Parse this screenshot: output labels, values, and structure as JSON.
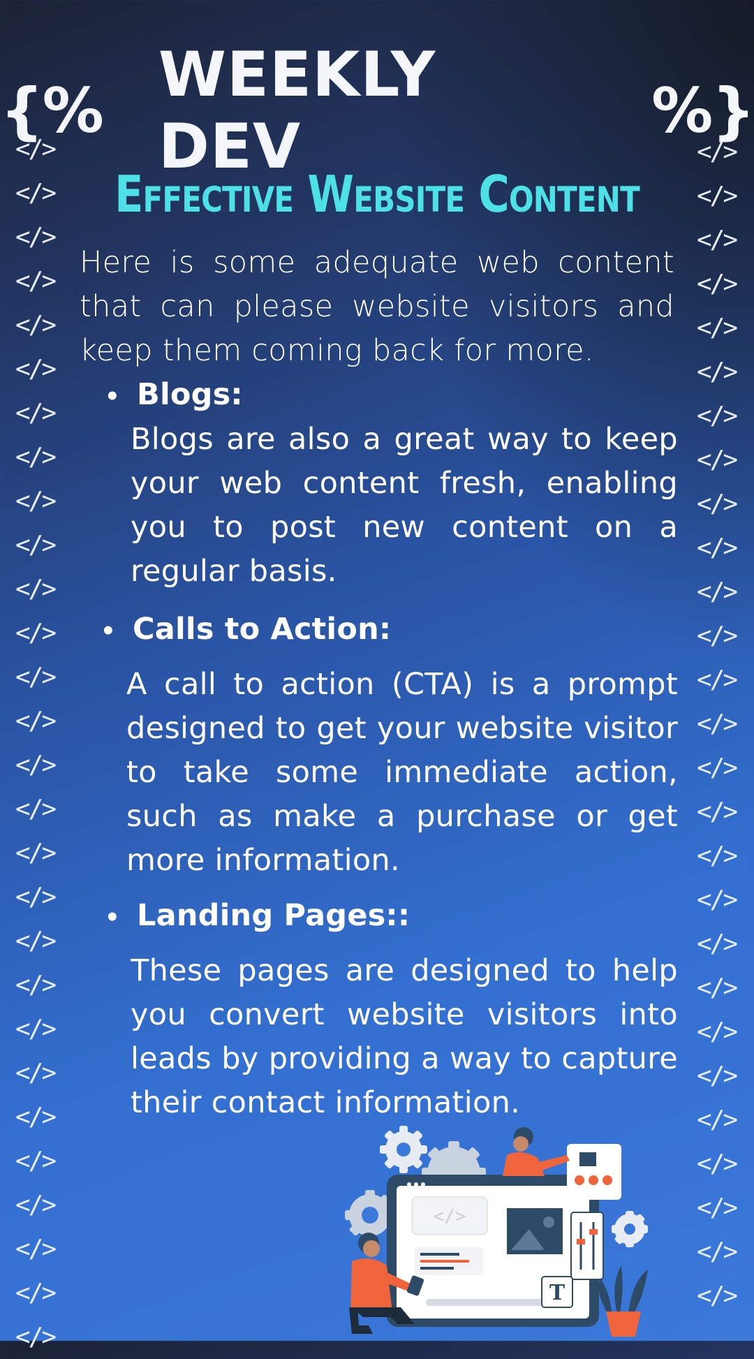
{
  "brand": {
    "open": "{%",
    "name": "WEEKLY DEV",
    "close": "%}"
  },
  "title": "Effective Website Content",
  "intro": "Here is some adequate web content that can please website visitors and keep them coming back for more.",
  "sections": [
    {
      "title": "Blogs:",
      "body": "Blogs are also a great way to keep your web content fresh, enabling you to post new content on a regular basis."
    },
    {
      "title": "Calls to Action:",
      "body": "A call to action (CTA) is a prompt designed to get your website visitor to take some immediate action, such as make a purchase or get more information."
    },
    {
      "title": "Landing Pages::",
      "body": "These pages are designed to help you convert website visitors into leads by providing a way to capture their contact information."
    }
  ],
  "code_tag": "</>",
  "bullet_glyph": "•",
  "illustration": {
    "code_label": "</>",
    "text_tool": "T"
  },
  "colors": {
    "title": "#4de0e6",
    "accent_orange": "#f0643c",
    "background_blue": "#3a78da"
  }
}
